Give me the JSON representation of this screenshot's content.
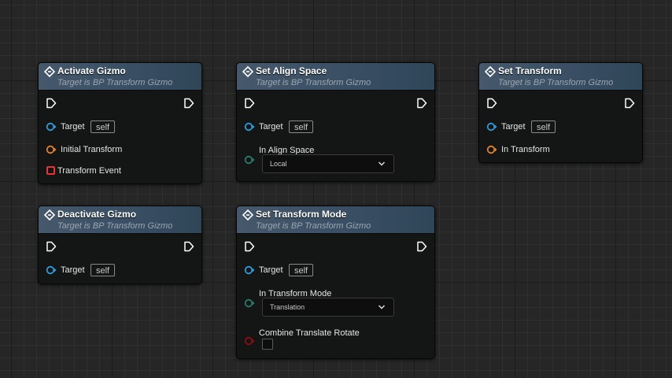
{
  "colors": {
    "exec": "#ffffff",
    "object_pin": "#2e9bd6",
    "struct_pin": "#e0822e",
    "delegate_pin": "#ff3838",
    "enum_pin": "#2a7a6e",
    "bool_pin": "#8b0f0f",
    "header": "#3c5166"
  },
  "nodes": {
    "activate_gizmo": {
      "title": "Activate Gizmo",
      "subtitle": "Target is BP Transform Gizmo",
      "target_label": "Target",
      "target_default": "self",
      "initial_transform_label": "Initial Transform",
      "transform_event_label": "Transform Event"
    },
    "deactivate_gizmo": {
      "title": "Deactivate Gizmo",
      "subtitle": "Target is BP Transform Gizmo",
      "target_label": "Target",
      "target_default": "self"
    },
    "set_align_space": {
      "title": "Set Align Space",
      "subtitle": "Target is BP Transform Gizmo",
      "target_label": "Target",
      "target_default": "self",
      "align_space_label": "In Align Space",
      "align_space_value": "Local"
    },
    "set_transform_mode": {
      "title": "Set Transform Mode",
      "subtitle": "Target is BP Transform Gizmo",
      "target_label": "Target",
      "target_default": "self",
      "mode_label": "In Transform Mode",
      "mode_value": "Translation",
      "combine_label": "Combine Translate Rotate"
    },
    "set_transform": {
      "title": "Set Transform",
      "subtitle": "Target is BP Transform Gizmo",
      "target_label": "Target",
      "target_default": "self",
      "in_transform_label": "In Transform"
    }
  }
}
